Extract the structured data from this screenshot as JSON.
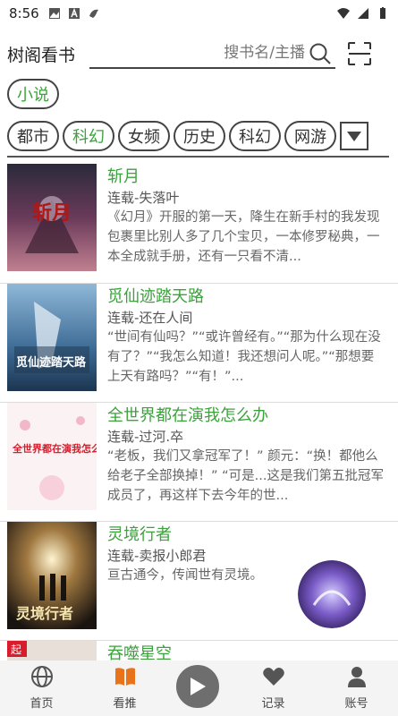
{
  "status_bar": {
    "time": "8:56"
  },
  "header": {
    "app_title": "树阁看书",
    "search_placeholder": "搜书名/主播"
  },
  "category": {
    "label": "小说"
  },
  "tags": [
    "都市",
    "科幻",
    "女频",
    "历史",
    "科幻",
    "网游"
  ],
  "active_tag_index": 1,
  "books": [
    {
      "title": "斩月",
      "author": "连载-失落叶",
      "desc": "《幻月》开服的第一天，降生在新手村的我发现包裹里比别人多了几个宝贝，一本修罗秘典，一本全成就手册，还有一只看不清..."
    },
    {
      "title": "觅仙迹踏天路",
      "author": "连载-还在人间",
      "desc": "“世间有仙吗？”“或许曾经有。”“那为什么现在没有了？”“我怎么知道！我还想问人呢。”“那想要上天有路吗？”“有！”..."
    },
    {
      "title": "全世界都在演我怎么办",
      "author": "连载-过河.卒",
      "desc": "“老板，我们又拿冠军了！” 颜元：“换！都他么给老子全部换掉！” “可是...这是我们第五批冠军成员了，再这样下去今年的世..."
    },
    {
      "title": "灵境行者",
      "author": "连载-卖报小郎君",
      "desc": "亘古通今，传闻世有灵境。"
    },
    {
      "title": "吞噬星空",
      "author": "",
      "desc": ""
    }
  ],
  "covers": [
    {
      "art_text": "斩月"
    },
    {
      "art_text": "觅仙迹踏天路"
    },
    {
      "art_text": "全世界都在演我怎么办"
    },
    {
      "art_text": "灵境行者"
    },
    {
      "art_text": "起"
    }
  ],
  "bottom_nav": [
    {
      "label": "首页",
      "icon": "globe-icon"
    },
    {
      "label": "看推",
      "icon": "book-icon"
    },
    {
      "label": "记录",
      "icon": "heart-icon"
    },
    {
      "label": "账号",
      "icon": "person-icon"
    }
  ],
  "colors": {
    "accent_green": "#3aa33a",
    "nav_active_orange": "#e8731a",
    "play_button": "#6e6e6e"
  }
}
